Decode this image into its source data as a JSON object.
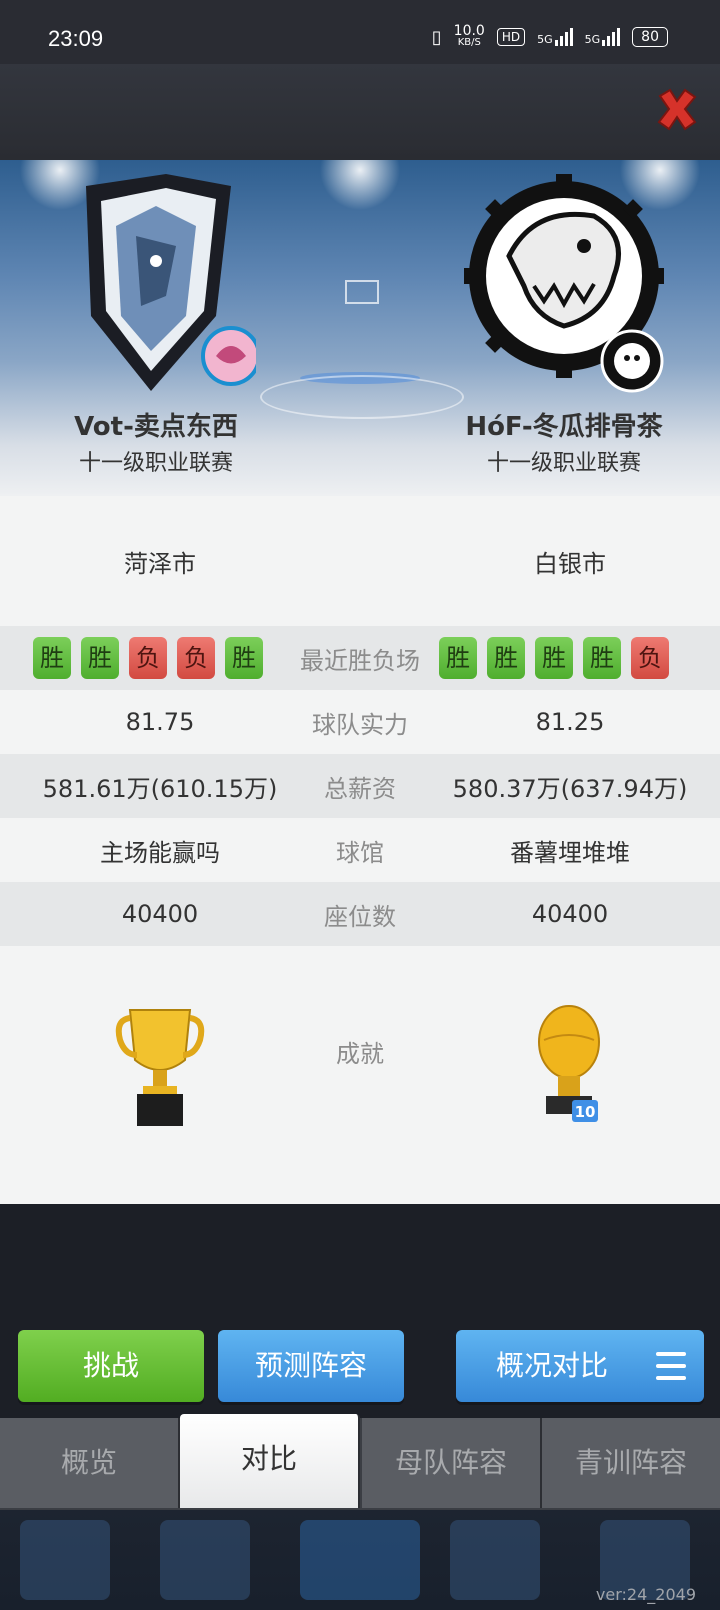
{
  "status_bar": {
    "time": "23:09",
    "net_speed_value": "10.0",
    "net_speed_unit": "KB/S",
    "hd_label": "HD",
    "signal1_label": "5G",
    "signal2_label": "5G",
    "battery": "80"
  },
  "header": {
    "close_icon": "close-x-icon"
  },
  "teams": {
    "home": {
      "name": "Vot-卖点东西",
      "league": "十一级职业联赛",
      "city": "菏泽市",
      "recent": [
        "胜",
        "胜",
        "负",
        "负",
        "胜"
      ],
      "strength": "81.75",
      "salary": "581.61万(610.15万)",
      "arena": "主场能赢吗",
      "seats": "40400"
    },
    "away": {
      "name": "HóF-冬瓜排骨茶",
      "league": "十一级职业联赛",
      "city": "白银市",
      "recent": [
        "胜",
        "胜",
        "胜",
        "胜",
        "负"
      ],
      "strength": "81.25",
      "salary": "580.37万(637.94万)",
      "arena": "番薯埋堆堆",
      "seats": "40400",
      "achievement_count": "10"
    }
  },
  "labels": {
    "recent": "最近胜负场",
    "strength": "球队实力",
    "salary": "总薪资",
    "arena": "球馆",
    "seats": "座位数",
    "achievement": "成就"
  },
  "buttons": {
    "challenge": "挑战",
    "predict": "预测阵容",
    "compare": "概况对比"
  },
  "tabs": [
    {
      "label": "概览",
      "active": false
    },
    {
      "label": "对比",
      "active": true
    },
    {
      "label": "母队阵容",
      "active": false
    },
    {
      "label": "青训阵容",
      "active": false
    }
  ],
  "version": "ver:24_2049",
  "colors": {
    "win": "#5bb93a",
    "loss": "#dc554c",
    "button_green": "#62bd33",
    "button_blue": "#4a9fe5"
  }
}
